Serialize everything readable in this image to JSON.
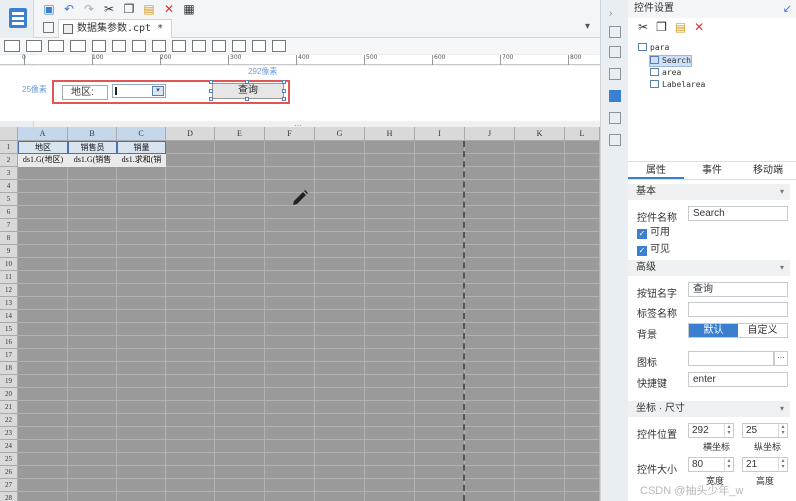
{
  "app": {
    "tab_title": "数据集参数.cpt *"
  },
  "toolbar": {
    "icons": [
      "save-icon",
      "undo-icon",
      "redo-icon",
      "cut-icon",
      "copy-icon",
      "paste-icon",
      "delete-icon",
      "preview-icon"
    ]
  },
  "ruler": {
    "labels": [
      "0",
      "100",
      "200",
      "300",
      "400",
      "500",
      "600",
      "700",
      "800"
    ]
  },
  "param_panel": {
    "width_hint": "292像素",
    "height_hint": "25像素",
    "area_label": "地区:",
    "query_button": "查询"
  },
  "sheet": {
    "columns": [
      "A",
      "B",
      "C",
      "D",
      "E",
      "F",
      "G",
      "H",
      "I",
      "J",
      "K",
      "L"
    ],
    "rows": [
      "1",
      "2",
      "3",
      "4",
      "5",
      "6",
      "7",
      "8",
      "9",
      "10",
      "11",
      "12",
      "13",
      "14",
      "15",
      "16",
      "17",
      "18",
      "19",
      "20",
      "21",
      "22",
      "23",
      "24",
      "25",
      "26",
      "27",
      "28"
    ],
    "header_cells": [
      "地区",
      "销售员",
      "销量"
    ],
    "data_cells": [
      "ds1.G(地区)",
      "ds1.G(销售",
      "ds1.求和(销"
    ]
  },
  "right_panel": {
    "title": "控件设置",
    "tree": {
      "root": "para",
      "items": [
        "Search",
        "area",
        "Labelarea"
      ]
    },
    "tabs": [
      "属性",
      "事件",
      "移动端"
    ],
    "sections": {
      "basic": "基本",
      "advanced": "高级",
      "coords": "坐标 · 尺寸"
    },
    "fields": {
      "control_name_label": "控件名称",
      "control_name_value": "Search",
      "enabled_label": "可用",
      "visible_label": "可见",
      "button_name_label": "按钮名字",
      "button_name_value": "查询",
      "tag_name_label": "标签名称",
      "tag_name_value": "",
      "background_label": "背景",
      "background_options": [
        "默认",
        "自定义"
      ],
      "icon_label": "图标",
      "shortcut_label": "快捷键",
      "shortcut_value": "enter",
      "position_label": "控件位置",
      "pos_x": "292",
      "pos_y": "25",
      "pos_x_label": "横坐标",
      "pos_y_label": "纵坐标",
      "size_label": "控件大小",
      "width_value": "80",
      "height_value": "21",
      "width_label": "宽度",
      "height_label": "高度"
    }
  },
  "watermark": "CSDN @抽头少年_w"
}
